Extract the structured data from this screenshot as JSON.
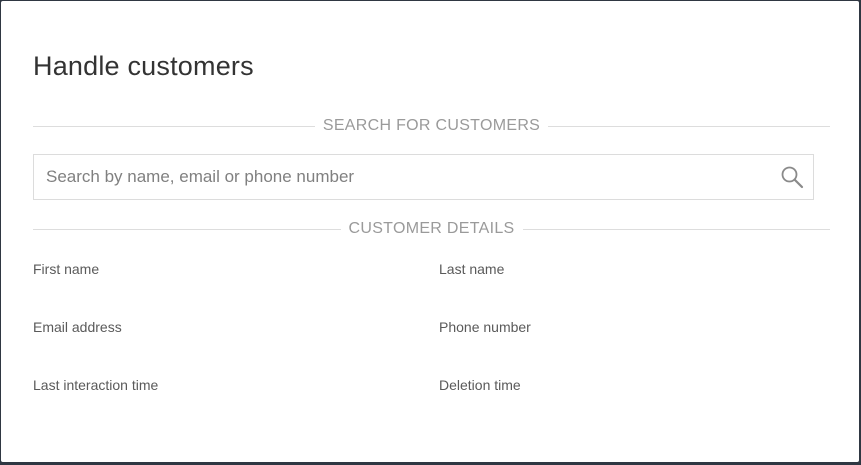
{
  "dialog": {
    "title": "Handle customers"
  },
  "search_section": {
    "heading": "SEARCH FOR CUSTOMERS",
    "placeholder": "Search by name, email or phone number",
    "value": "",
    "icon": "search-icon"
  },
  "details_section": {
    "heading": "CUSTOMER DETAILS",
    "fields": [
      {
        "label": "First name"
      },
      {
        "label": "Last name"
      },
      {
        "label": "Email address"
      },
      {
        "label": "Phone number"
      },
      {
        "label": "Last interaction time"
      },
      {
        "label": "Deletion time"
      }
    ]
  },
  "colors": {
    "background": "#2f3742",
    "dialog": "#ffffff",
    "divider": "#dddddd",
    "heading_text": "#9a9a9a"
  }
}
